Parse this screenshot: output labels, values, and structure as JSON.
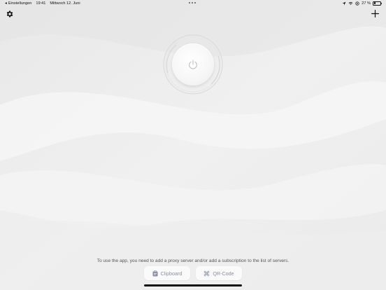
{
  "status_bar": {
    "back_label": "Einstellungen",
    "time": "19:41",
    "date": "Mittwoch 12. Juni",
    "battery": "27 %",
    "battery_level": 0.27
  },
  "top_bar": {
    "settings_icon": "gear-icon",
    "add_icon": "plus-icon"
  },
  "main": {
    "power_icon": "power-icon",
    "info_text": "To use the app, you need to add a proxy server and/or add a subscription to the list of servers."
  },
  "actions": {
    "clipboard_label": "Clipboard",
    "clipboard_icon": "clipboard-icon",
    "qr_label": "QR-Code",
    "qr_icon": "command-icon"
  },
  "colors": {
    "background": "#ededed",
    "button_bg": "#fafafa",
    "button_text": "#8a8ea0"
  }
}
